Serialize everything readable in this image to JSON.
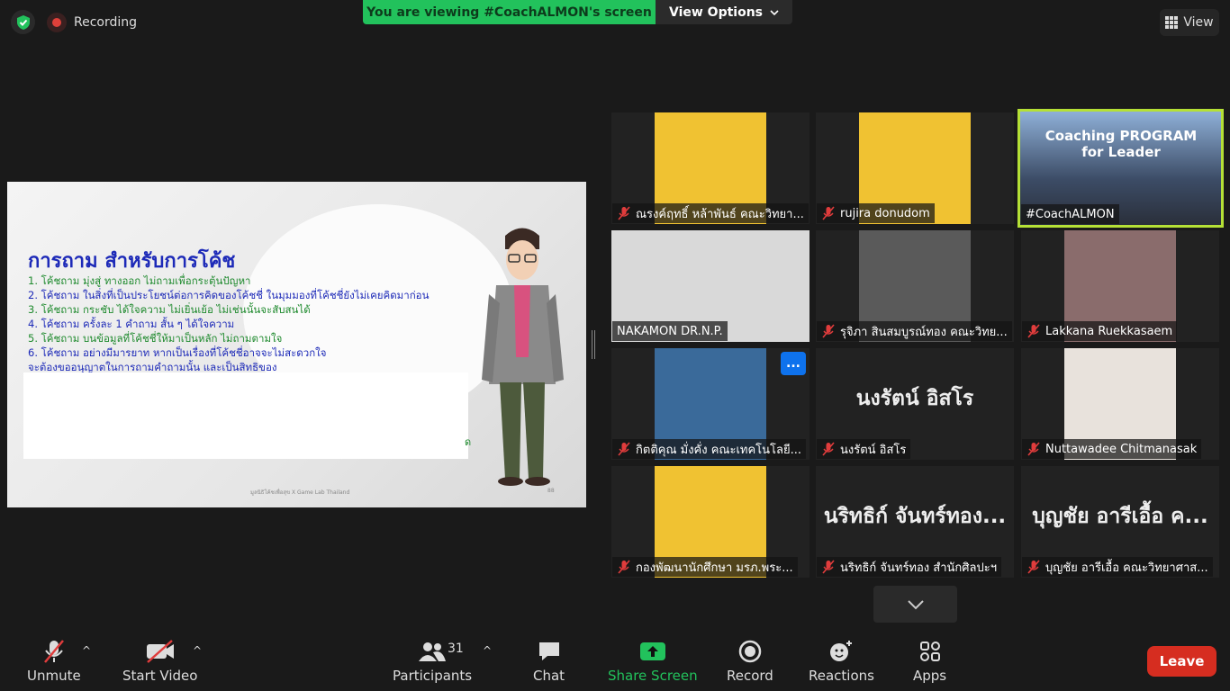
{
  "topbar": {
    "recording_label": "Recording",
    "viewing_banner": "You are viewing #CoachALMON's screen",
    "view_options_label": "View Options",
    "view_label": "View"
  },
  "slide": {
    "title": "การถาม สำหรับการโค้ช",
    "lines": [
      "1. โค้ชถาม มุ่งสู่ ทางออก ไม่ถามเพื่อกระตุ้นปัญหา",
      "2. โค้ชถาม ในสิ่งที่เป็นประโยชน์ต่อการคิดของโค้ชชี่ ในมุมมองที่โค้ชชี่ยังไม่เคยคิดมาก่อน",
      "3. โค้ชถาม กระชับ ได้ใจความ ไม่เยิ่นเย้อ ไม่เช่นนั้นจะสับสนได้",
      "4. โค้ชถาม ครั้งละ 1 คำถาม สั้น ๆ ได้ใจความ",
      "5. โค้ชถาม บนข้อมูลที่โค้ชชี่ให้มาเป็นหลัก ไม่ถามตามใจ",
      "6. โค้ชถาม อย่างมีมารยาท หากเป็นเรื่องที่โค้ชชี่อาจจะไม่สะดวกใจ",
      "    จะต้องขออนุญาตในการถามคำถามนั้น และเป็นสิทธิของ"
    ],
    "tail_char": "ด",
    "footer": "มูลนิธิโค้ชเพื่อสุข X Game Lab Thailand",
    "page_no": "88"
  },
  "participants": [
    {
      "name": "ณรงค์ฤทธิ์ หล้าพันธ์ คณะวิทยา...",
      "muted": true,
      "bg": "yellow"
    },
    {
      "name": "rujira donudom",
      "muted": true,
      "bg": "yellow"
    },
    {
      "name": "#CoachALMON",
      "muted": false,
      "bg": "photo",
      "active": true,
      "overlay_text": "Coaching PROGRAM for Leader"
    },
    {
      "name": "NAKAMON DR.N.P.",
      "muted": false,
      "bg": "gray"
    },
    {
      "name": "รุจิภา สินสมบูรณ์ทอง คณะวิทย...",
      "muted": true,
      "bg": "gray"
    },
    {
      "name": "Lakkana Ruekkasaem",
      "muted": true,
      "bg": "photo"
    },
    {
      "name": "กิตติคุณ มั่งคั่ง คณะเทคโนโลยี...",
      "muted": true,
      "bg": "photo"
    },
    {
      "name": "นงรัตน์ อิสโร",
      "muted": true,
      "bg": "none",
      "big": "นงรัตน์ อิสโร"
    },
    {
      "name": "Nuttawadee Chitmanasak",
      "muted": true,
      "bg": "gray"
    },
    {
      "name": "กองพัฒนานักศึกษา มรภ.พระ...",
      "muted": true,
      "bg": "yellow"
    },
    {
      "name": "นริทธิก์ จันทร์ทอง สำนักศิลปะฯ",
      "muted": true,
      "bg": "none",
      "big": "นริทธิก์ จันทร์ทอง..."
    },
    {
      "name": "บุญชัย อารีเอื้อ คณะวิทยาศาส...",
      "muted": true,
      "bg": "none",
      "big": "บุญชัย อารีเอื้อ ค..."
    }
  ],
  "more_button_label": "...",
  "toolbar": {
    "unmute": "Unmute",
    "start_video": "Start Video",
    "participants": "Participants",
    "participants_count": "31",
    "chat": "Chat",
    "share_screen": "Share Screen",
    "record": "Record",
    "reactions": "Reactions",
    "apps": "Apps",
    "leave": "Leave"
  },
  "colors": {
    "share_green": "#22c25c",
    "leave_red": "#d62d20",
    "active_speaker": "#b5e036",
    "slide_blue": "#1d2ab8",
    "slide_green": "#1f8a2e"
  }
}
